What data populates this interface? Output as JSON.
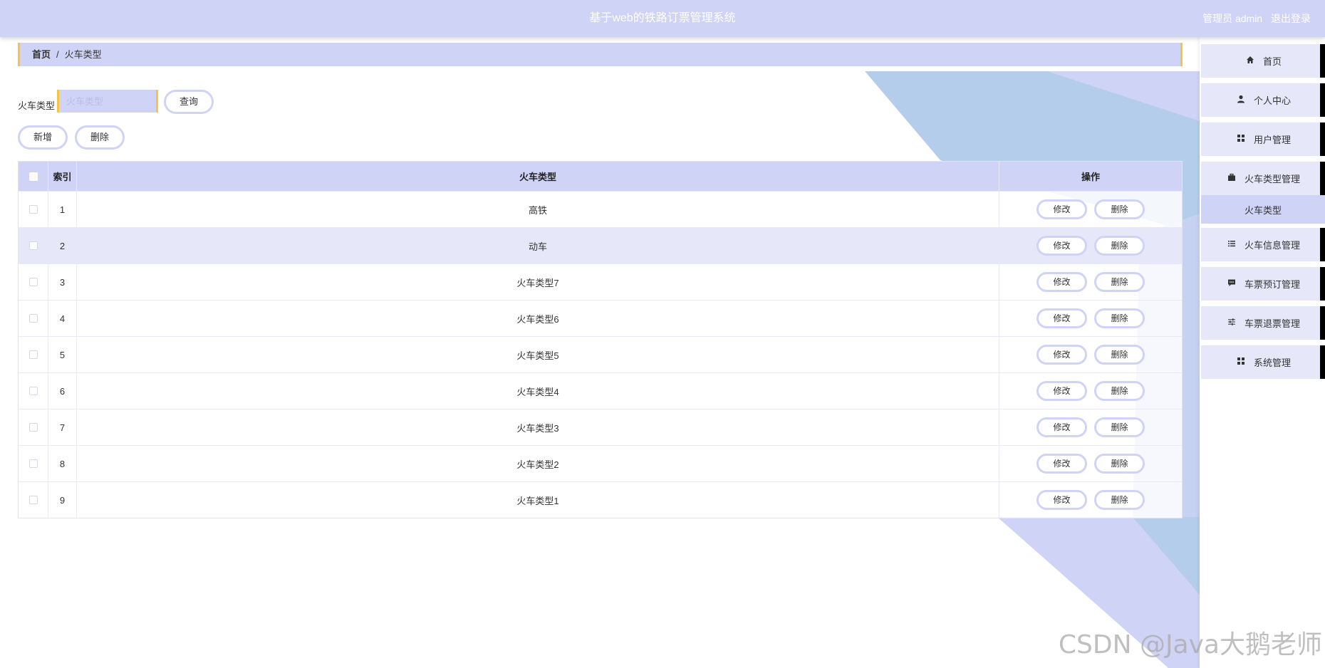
{
  "header": {
    "title": "基于web的铁路订票管理系统",
    "role_user": "管理员 admin",
    "logout": "退出登录"
  },
  "breadcrumb": {
    "home": "首页",
    "separator": "/",
    "current": "火车类型"
  },
  "search": {
    "label": "火车类型",
    "placeholder": "火车类型",
    "query_button": "查询"
  },
  "actions": {
    "add": "新增",
    "delete": "删除"
  },
  "table": {
    "columns": {
      "index": "索引",
      "type": "火车类型",
      "ops": "操作"
    },
    "op_edit": "修改",
    "op_delete": "删除",
    "rows": [
      {
        "index": "1",
        "type": "高铁"
      },
      {
        "index": "2",
        "type": "动车"
      },
      {
        "index": "3",
        "type": "火车类型7"
      },
      {
        "index": "4",
        "type": "火车类型6"
      },
      {
        "index": "5",
        "type": "火车类型5"
      },
      {
        "index": "6",
        "type": "火车类型4"
      },
      {
        "index": "7",
        "type": "火车类型3"
      },
      {
        "index": "8",
        "type": "火车类型2"
      },
      {
        "index": "9",
        "type": "火车类型1"
      }
    ]
  },
  "sidebar": {
    "items": [
      {
        "label": "首页",
        "icon": "home-icon"
      },
      {
        "label": "个人中心",
        "icon": "user-icon"
      },
      {
        "label": "用户管理",
        "icon": "grid-icon"
      },
      {
        "label": "火车类型管理",
        "icon": "briefcase-icon"
      },
      {
        "label": "火车信息管理",
        "icon": "list-icon"
      },
      {
        "label": "车票预订管理",
        "icon": "chat-icon"
      },
      {
        "label": "车票退票管理",
        "icon": "sliders-icon"
      },
      {
        "label": "系统管理",
        "icon": "grid-icon"
      }
    ],
    "sub_item": "火车类型"
  },
  "watermark": "CSDN @Java大鹅老师",
  "colors": {
    "accent": "#cfd3f6",
    "highlight_row": "#e6e8fa",
    "border_yellow": "#f5c542",
    "decor_blue": "#b3cdeb"
  }
}
